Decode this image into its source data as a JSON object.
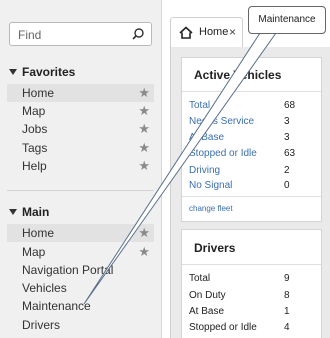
{
  "search": {
    "placeholder": "Find"
  },
  "favorites": {
    "title": "Favorites",
    "items": [
      {
        "label": "Home",
        "active": true
      },
      {
        "label": "Map"
      },
      {
        "label": "Jobs"
      },
      {
        "label": "Tags"
      },
      {
        "label": "Help"
      }
    ]
  },
  "main_nav": {
    "title": "Main",
    "items": [
      {
        "label": "Home",
        "active": true
      },
      {
        "label": "Map"
      },
      {
        "label": "Navigation Portal"
      },
      {
        "label": "Vehicles"
      },
      {
        "label": "Maintenance"
      },
      {
        "label": "Drivers"
      }
    ]
  },
  "tab": {
    "label": "Home",
    "close": "×"
  },
  "active_vehicles": {
    "title": "Active Vehicles",
    "rows": [
      {
        "name": "Total",
        "value": "68"
      },
      {
        "name": "Needs Service",
        "value": "3"
      },
      {
        "name": "At Base",
        "value": "3"
      },
      {
        "name": "Stopped or Idle",
        "value": "63"
      },
      {
        "name": "Driving",
        "value": "2"
      },
      {
        "name": "No Signal",
        "value": "0"
      }
    ],
    "link": "change fleet"
  },
  "drivers": {
    "title": "Drivers",
    "rows": [
      {
        "name": "Total",
        "value": "9"
      },
      {
        "name": "On Duty",
        "value": "8"
      },
      {
        "name": "At Base",
        "value": "1"
      },
      {
        "name": "Stopped or Idle",
        "value": "4"
      }
    ]
  },
  "callout": {
    "text": "Maintenance"
  },
  "colors": {
    "link": "#3a6fb0",
    "active_row": "#e2e2e2",
    "sidebar_bg": "#f0f0f0"
  }
}
